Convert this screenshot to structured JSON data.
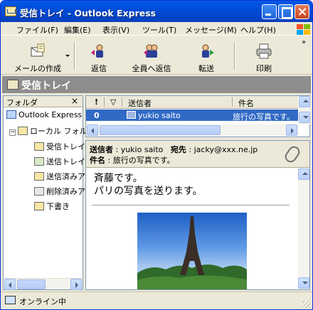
{
  "window": {
    "title": "受信トレイ - Outlook Express"
  },
  "menubar": {
    "items": [
      "ファイル(F)",
      "編集(E)",
      "表示(V)",
      "ツール(T)",
      "メッセージ(M)",
      "ヘルプ(H)"
    ]
  },
  "toolbar": {
    "new_mail": "メールの作成",
    "reply": "返信",
    "reply_all": "全員へ返信",
    "forward": "転送",
    "print": "印刷",
    "overflow": "»"
  },
  "folder_bar": {
    "title": "受信トレイ"
  },
  "folders_pane": {
    "header": "フォルダ",
    "close": "×",
    "items": [
      {
        "label": "Outlook Express",
        "icon": "outlook-express-icon"
      },
      {
        "label": "ローカル フォルダ",
        "icon": "local-folders-icon"
      },
      {
        "label": "受信トレイ",
        "icon": "inbox-icon"
      },
      {
        "label": "送信トレイ",
        "icon": "outbox-icon"
      },
      {
        "label": "送信済みアイテム",
        "icon": "sent-items-icon"
      },
      {
        "label": "削除済みアイテム",
        "icon": "deleted-items-icon"
      },
      {
        "label": "下書き",
        "icon": "drafts-icon"
      }
    ]
  },
  "message_list": {
    "columns": {
      "attachment": "!",
      "flag": "▽",
      "from": "送信者",
      "subject": "件名"
    },
    "rows": [
      {
        "attachment": "0",
        "from": "yukio saito",
        "subject": "旅行の写真です。"
      }
    ]
  },
  "preview": {
    "from_label": "送信者",
    "from_value": "yukio saito",
    "to_label": "宛先",
    "to_value": "jacky@xxx.ne.jp",
    "subject_label": "件名",
    "subject_value": "旅行の写真です。",
    "body_line1": "斉藤です。",
    "body_line2": "パリの写真を送ります。"
  },
  "statusbar": {
    "text": "オンライン中"
  }
}
